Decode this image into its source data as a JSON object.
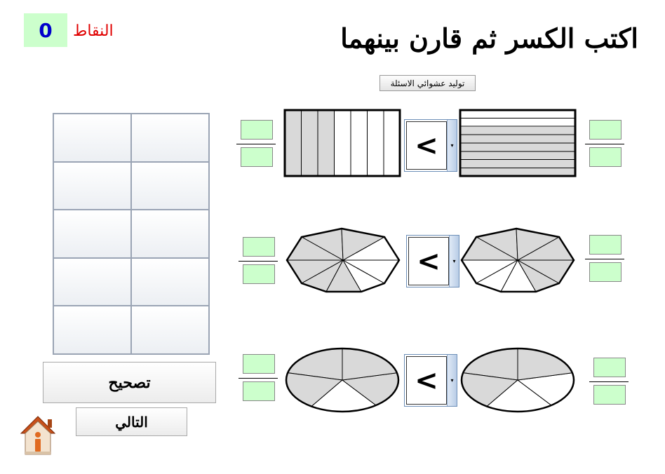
{
  "header": {
    "title": "اكتب الكسر ثم قارن بينهما",
    "score_label": "النقاط",
    "score_value": "0",
    "generate_button": "توليد عشوائي الاسئلة"
  },
  "buttons": {
    "check": "تصحيح",
    "next": "التالي"
  },
  "comparisons": [
    {
      "operator": "<",
      "left_shape": "rectangle-vertical-strips",
      "right_shape": "rectangle-horizontal-strips"
    },
    {
      "operator": "<",
      "left_shape": "octagon-sectors",
      "right_shape": "octagon-sectors"
    },
    {
      "operator": "<",
      "left_shape": "ellipse-sectors",
      "right_shape": "ellipse-sectors"
    }
  ],
  "dropdown_arrow": "▾",
  "icons": {
    "home": "home-icon"
  },
  "colors": {
    "input_bg": "#ccffcc",
    "score_color": "#0000cc",
    "label_color": "#e00000",
    "shade": "#d9d9d9"
  }
}
